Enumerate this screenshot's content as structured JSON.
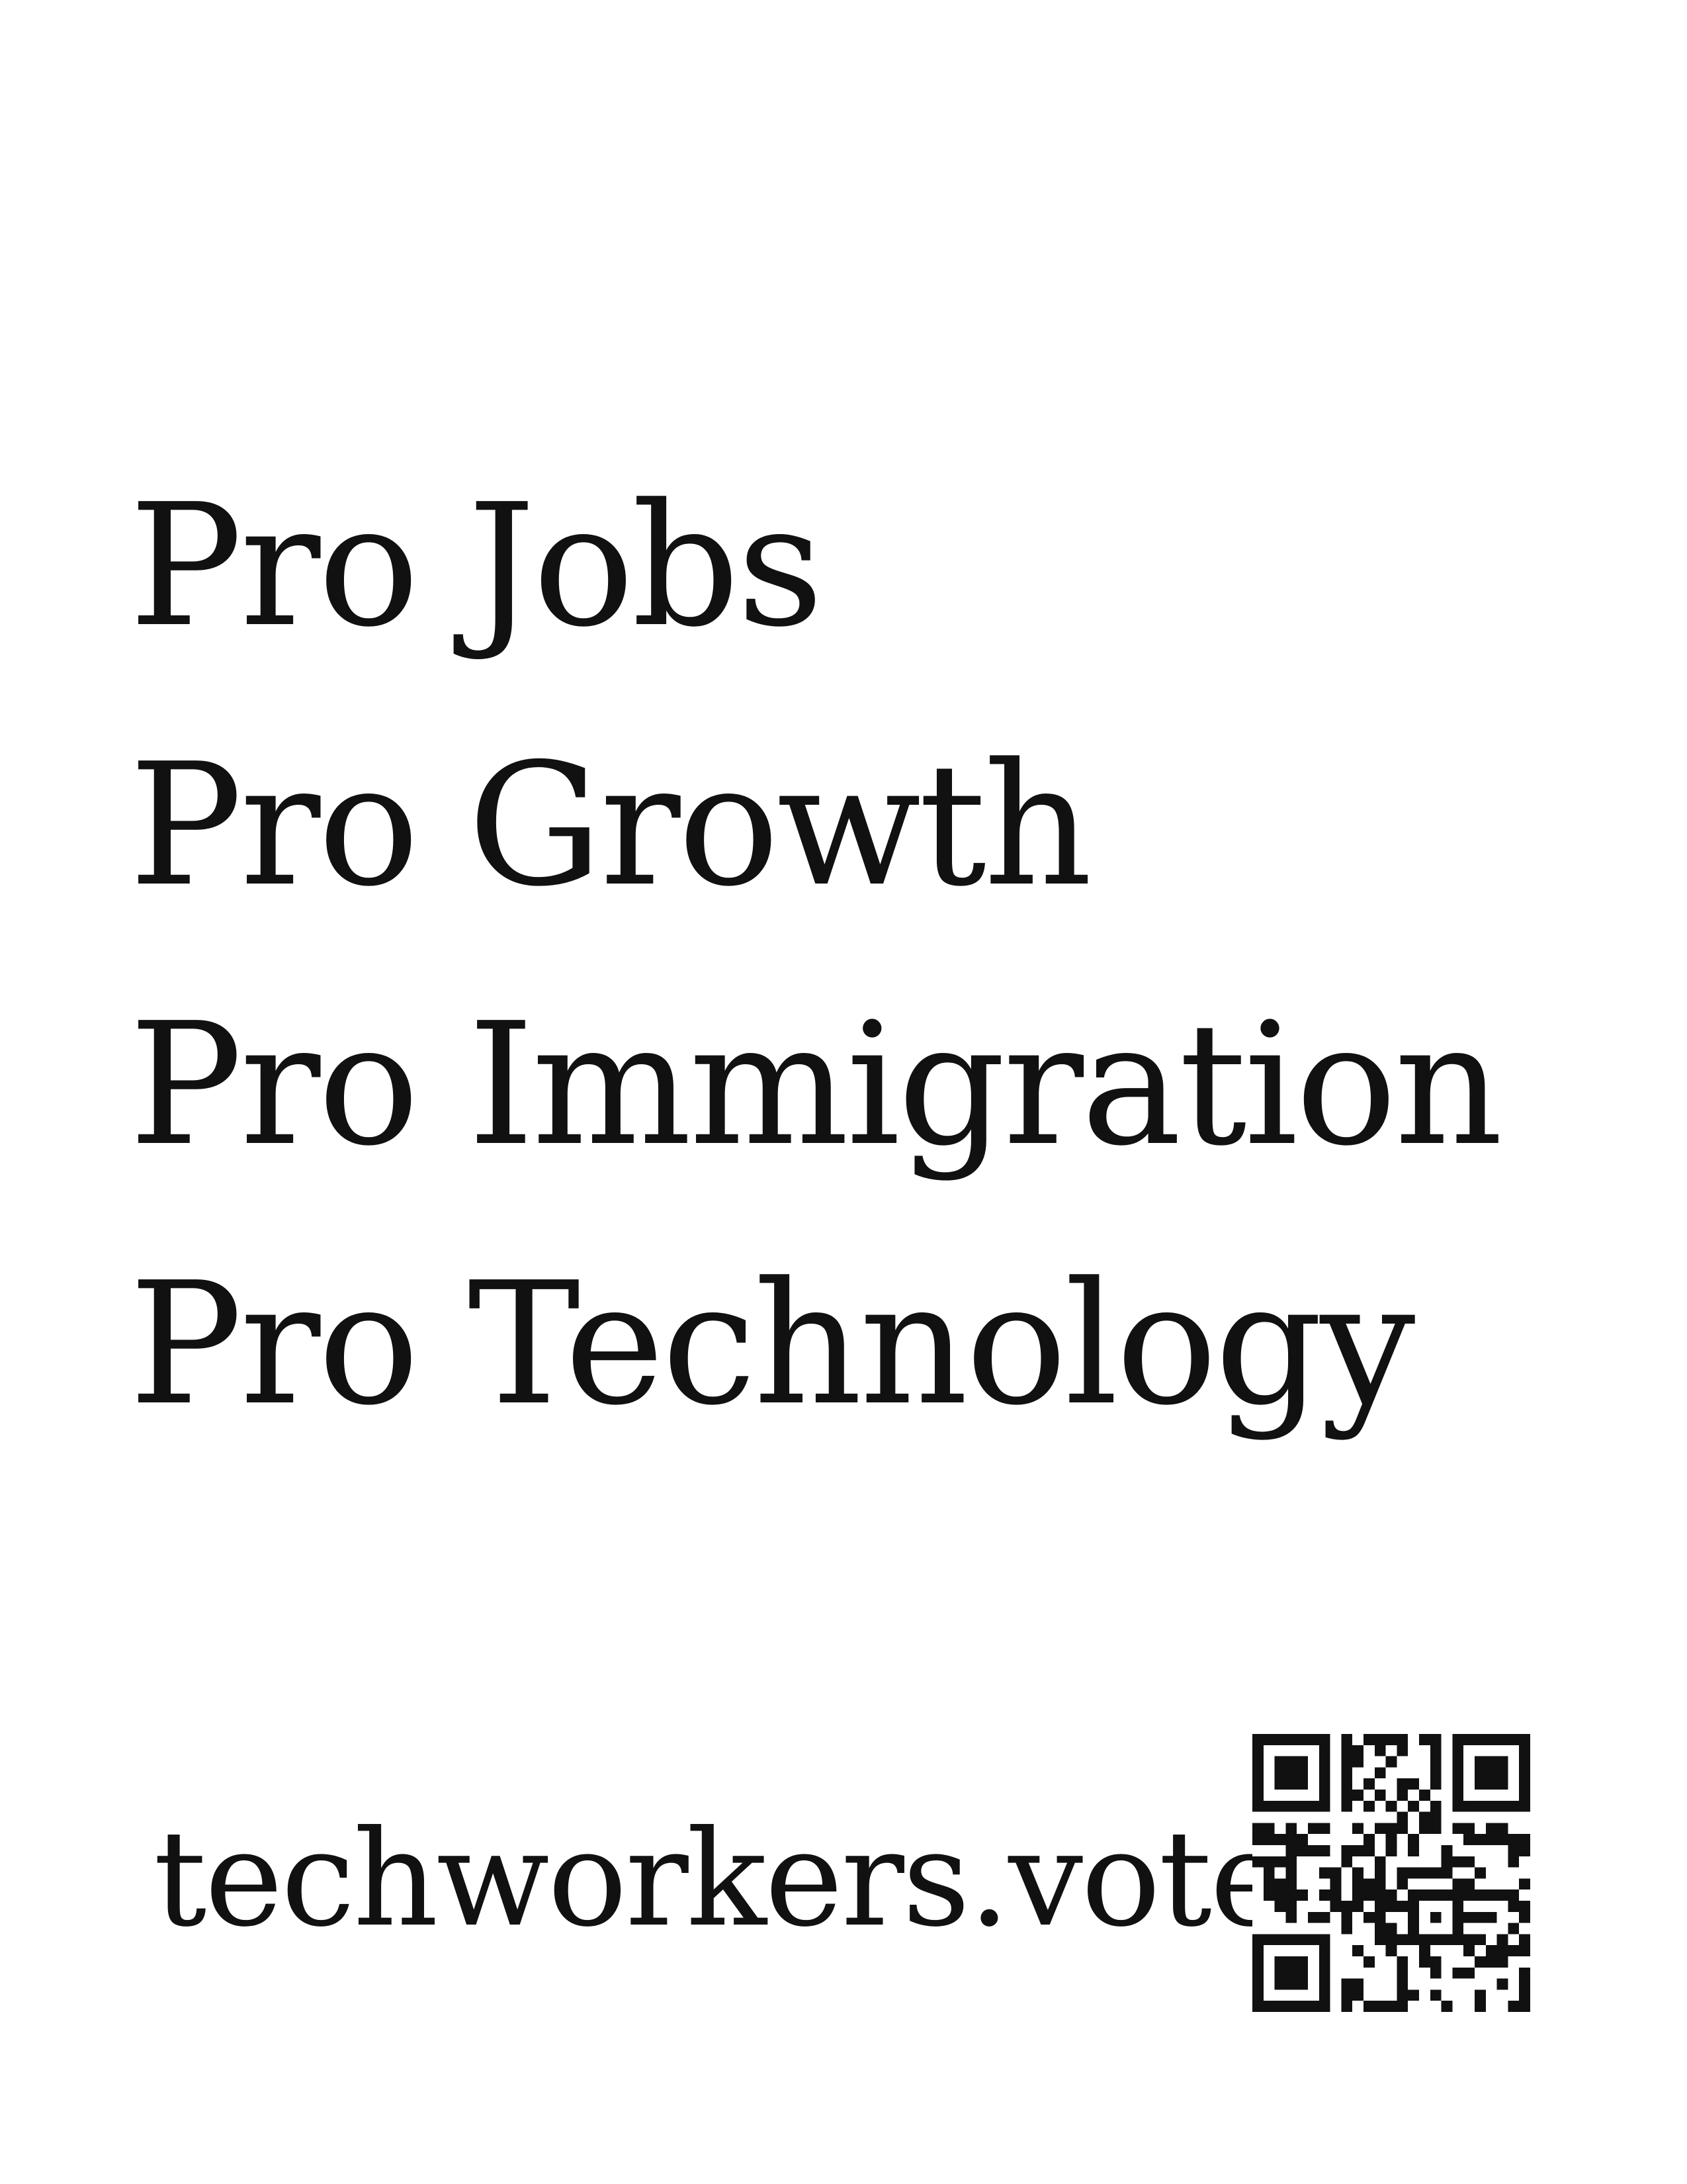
{
  "slogans": [
    "Pro Jobs",
    "Pro Growth",
    "Pro Immigration",
    "Pro Technology"
  ],
  "footer": {
    "url": "techworkers.vote"
  },
  "qr_code": {
    "icon": "qr-code-icon",
    "color": "#111111",
    "background": "#ffffff"
  }
}
